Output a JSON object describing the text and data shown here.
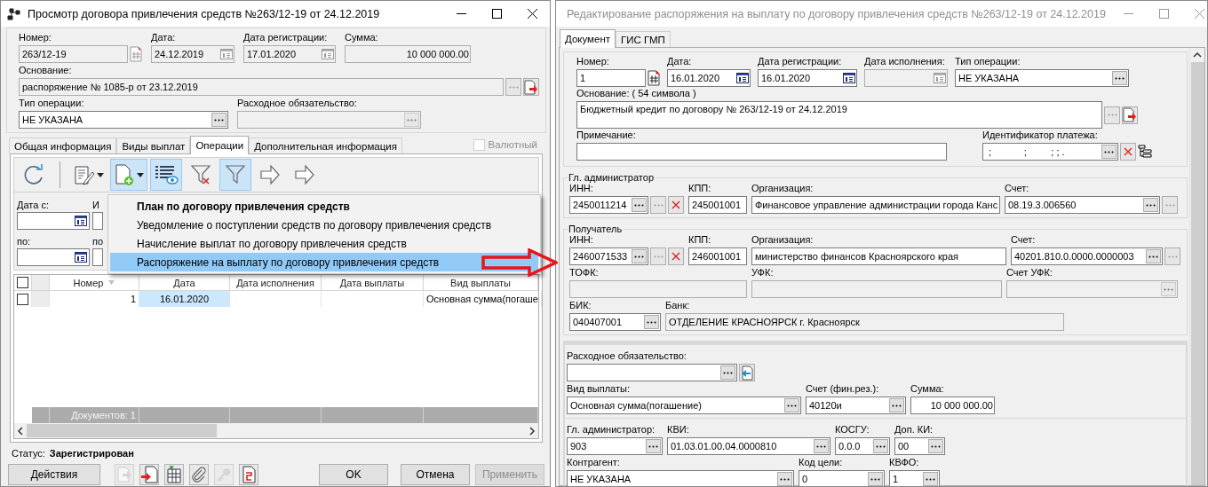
{
  "contract_window": {
    "title": "Просмотр договора привлечения средств №263/12-19 от 24.12.2019",
    "active": true,
    "fields": [
      {
        "label": "Номер:",
        "value": "263/12-19",
        "kind": "text",
        "disabled": true,
        "numbering_button": true
      },
      {
        "label": "Дата:",
        "value": "24.12.2019",
        "kind": "date",
        "disabled": true
      },
      {
        "label": "Дата регистрации:",
        "value": "17.01.2020",
        "kind": "date",
        "disabled": true
      },
      {
        "label": "Сумма:",
        "value": "10 000 000.00",
        "kind": "amount",
        "disabled": true
      },
      {
        "label": "Основание:",
        "value": "распоряжение № 1085-р от 23.12.2019",
        "kind": "text",
        "disabled": true,
        "browse_button": true,
        "open_doc_button": true
      },
      {
        "label": "Тип операции:",
        "value": "НЕ УКАЗАНА",
        "kind": "lookup",
        "disabled": false
      },
      {
        "label": "Расходное обязательство:",
        "kind": "lookup",
        "disabled": true
      }
    ],
    "tabs": [
      {
        "label": "Общая информация",
        "selected": false
      },
      {
        "label": "Виды выплат",
        "selected": false
      },
      {
        "label": "Операции",
        "selected": true
      },
      {
        "label": "Дополнительная информация",
        "selected": false
      }
    ],
    "currency_checkbox": {
      "label": "Валютный",
      "checked": false,
      "disabled": true
    },
    "toolbar": [
      {
        "kind": "refresh",
        "pressed": false,
        "dropdown": false
      },
      {
        "kind": "separator"
      },
      {
        "kind": "edit",
        "pressed": false,
        "dropdown": true
      },
      {
        "kind": "add",
        "pressed": true,
        "dropdown": true
      },
      {
        "kind": "list-view",
        "pressed": true,
        "dropdown": false
      },
      {
        "kind": "filter-clear",
        "pressed": false,
        "dropdown": false
      },
      {
        "kind": "filter",
        "pressed": true,
        "dropdown": false
      },
      {
        "kind": "arrow-right",
        "pressed": false,
        "dropdown": false
      },
      {
        "kind": "arrow-right",
        "pressed": false,
        "dropdown": false
      }
    ],
    "filters": [
      {
        "label": "Дата с:",
        "kind": "date"
      },
      {
        "label": "И",
        "kind": "text"
      },
      {
        "label": "по:",
        "kind": "date"
      },
      {
        "label": "по",
        "kind": "text"
      }
    ],
    "grid": {
      "all_checked": false,
      "columns": [
        {
          "label": "Номер",
          "sorted": true
        },
        {
          "label": "Дата",
          "sorted": false
        },
        {
          "label": "Дата исполнения",
          "sorted": false
        },
        {
          "label": "Дата выплаты",
          "sorted": false
        },
        {
          "label": "Вид выплаты",
          "sorted": false
        }
      ],
      "rows": [
        {
          "checked": false,
          "cells": [
            {
              "text": "1",
              "focused": false
            },
            {
              "text": "16.01.2020",
              "focused": true
            },
            {
              "focused": false
            },
            {
              "focused": false
            },
            {
              "text": "Основная сумма(погаше",
              "focused": false
            }
          ]
        }
      ],
      "footer": "Документов: 1"
    },
    "menu": {
      "items": [
        {
          "label": "План по договору привлечения средств",
          "default": true,
          "selected": false
        },
        {
          "label": "Уведомление о поступлении средств по договору привлечения средств",
          "default": false,
          "selected": false
        },
        {
          "label": "Начисление выплат по договору привлечения средств",
          "default": false,
          "selected": false
        },
        {
          "label": "Распоряжение на выплату по договору привлечения средств",
          "default": false,
          "selected": true
        }
      ]
    },
    "status": {
      "label": "Статус:",
      "value": "Зарегистрирован"
    },
    "actions_button": "Действия",
    "doc_tools": [
      {
        "kind": "export",
        "disabled": true
      },
      {
        "kind": "import",
        "disabled": false
      },
      {
        "kind": "spreadsheet",
        "disabled": false
      },
      {
        "kind": "attach",
        "disabled": false
      },
      {
        "kind": "key",
        "disabled": true
      },
      {
        "kind": "print",
        "disabled": false
      }
    ],
    "buttons": [
      {
        "label": "OK",
        "disabled": false
      },
      {
        "label": "Отмена",
        "disabled": false
      },
      {
        "label": "Применить",
        "disabled": true
      }
    ]
  },
  "order_window": {
    "title": "Редактирование распоряжения на выплату по договору привлечения средств №263/12-19 от 24.12.2019",
    "active": false,
    "tabs": [
      {
        "label": "Документ",
        "selected": true
      },
      {
        "label": "ГИС ГМП",
        "selected": false
      }
    ],
    "header_fields": [
      {
        "label": "Номер:",
        "value": "1",
        "kind": "text",
        "disabled": false,
        "numbering_button": true
      },
      {
        "label": "Дата:",
        "value": "16.01.2020",
        "kind": "date",
        "disabled": false
      },
      {
        "label": "Дата регистрации:",
        "value": "16.01.2020",
        "kind": "date",
        "disabled": false
      },
      {
        "label": "Дата исполнения:",
        "kind": "date",
        "disabled": true
      },
      {
        "label": "Тип операции:",
        "value": "НЕ УКАЗАНА",
        "kind": "lookup",
        "disabled": false
      },
      {
        "label": "Основание: ( 54  символа )",
        "value": "Бюджетный кредит по договору № 263/12-19 от 24.12.2019",
        "kind": "text",
        "disabled": false,
        "browse_button": true,
        "open_doc_button": true
      },
      {
        "label": "Примечание:",
        "kind": "text",
        "disabled": false
      },
      {
        "label": "Идентификатор платежа:",
        "value": " ;            ;         ; ; .",
        "kind": "lookup",
        "disabled": false,
        "clear_button": true,
        "tree_button": true
      }
    ],
    "admin_group": {
      "legend": "Гл. администратор",
      "fields": [
        {
          "label": "ИНН:",
          "value": "2450011214",
          "kind": "lookup",
          "disabled": false,
          "browse_button": true,
          "clear_button": true
        },
        {
          "label": "КПП:",
          "value": "245001001",
          "kind": "text",
          "disabled": false
        },
        {
          "label": "Организация:",
          "value": "Финансовое управление администрации города Канс",
          "kind": "text",
          "disabled": false
        },
        {
          "label": "Счет:",
          "value": "08.19.3.006560",
          "kind": "lookup",
          "disabled": false,
          "browse_button": true
        }
      ]
    },
    "recipient_group": {
      "legend": "Получатель",
      "fields": [
        {
          "label": "ИНН:",
          "value": "2460071533",
          "kind": "lookup",
          "disabled": false,
          "browse_button": true,
          "clear_button": true
        },
        {
          "label": "КПП:",
          "value": "246001001",
          "kind": "text",
          "disabled": false
        },
        {
          "label": "Организация:",
          "value": "министерство финансов Красноярского края",
          "kind": "text",
          "disabled": false
        },
        {
          "label": "Счет:",
          "value": "40201.810.0.0000.0000003",
          "kind": "lookup",
          "disabled": false,
          "browse_button": true
        },
        {
          "label": "ТОФК:",
          "kind": "text",
          "disabled": true
        },
        {
          "label": "УФК:",
          "kind": "text",
          "disabled": true
        },
        {
          "label": "Счет УФК:",
          "kind": "lookup",
          "disabled": true
        },
        {
          "label": "БИК:",
          "value": "040407001",
          "kind": "lookup",
          "disabled": false
        },
        {
          "label": "Банк:",
          "value": "ОТДЕЛЕНИЕ КРАСНОЯРСК г. Красноярск",
          "kind": "text",
          "disabled": true
        }
      ]
    },
    "payment_fields": [
      {
        "label": "Расходное обязательство:",
        "kind": "lookup",
        "disabled": false,
        "back_doc_button": true
      },
      {
        "label": "Вид выплаты:",
        "value": "Основная сумма(погашение)",
        "kind": "lookup",
        "disabled": false
      },
      {
        "label": "Счет (фин.рез.):",
        "value": "40120и",
        "kind": "lookup",
        "disabled": false
      },
      {
        "label": "Сумма:",
        "value": "10 000 000.00",
        "kind": "amount",
        "disabled": false
      },
      {
        "label": "Гл. администратор:",
        "value": "903",
        "kind": "lookup",
        "disabled": false
      },
      {
        "label": "КВИ:",
        "value": "01.03.01.00.04.0000810",
        "kind": "lookup",
        "disabled": false
      },
      {
        "label": "КОСГУ:",
        "value": "0.0.0",
        "kind": "lookup",
        "disabled": false
      },
      {
        "label": "Доп. КИ:",
        "value": "00",
        "kind": "lookup",
        "disabled": false
      },
      {
        "label": "Контрагент:",
        "value": "НЕ УКАЗАНА",
        "kind": "lookup",
        "disabled": false
      },
      {
        "label": "Код цели:",
        "value": "0",
        "kind": "lookup",
        "disabled": false
      },
      {
        "label": "КВФО:",
        "value": "1",
        "kind": "lookup",
        "disabled": false
      }
    ]
  }
}
